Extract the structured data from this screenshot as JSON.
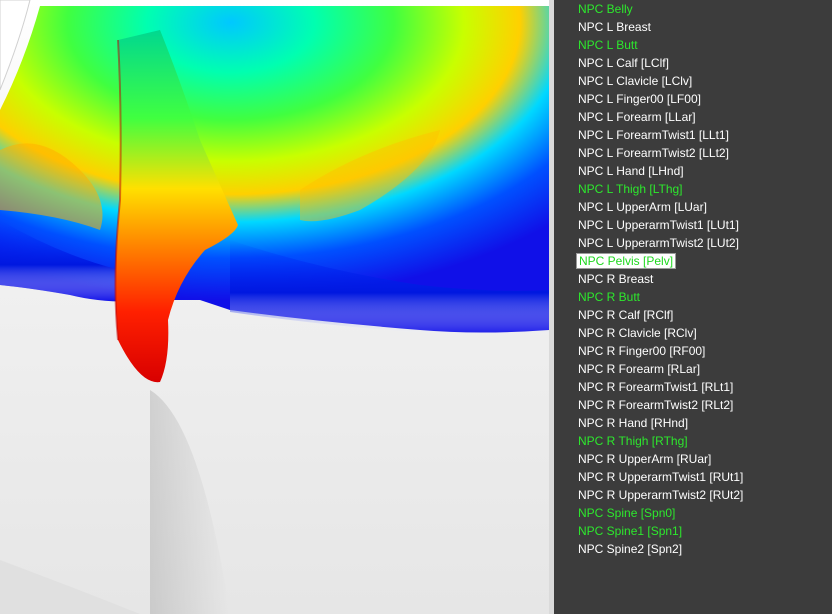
{
  "viewport": {
    "label": "3d-viewport",
    "heatmap_colors": [
      "#ff0000",
      "#ffaa00",
      "#ffff00",
      "#7fff00",
      "#00ff7f",
      "#00ffff",
      "#0080ff",
      "#0000ff",
      "#ffffff"
    ]
  },
  "bones": {
    "weighted_color": "#2de82d",
    "normal_color": "#ffffff",
    "items": [
      {
        "label": "NPC Belly",
        "weighted": true
      },
      {
        "label": "NPC L Breast",
        "weighted": false
      },
      {
        "label": "NPC L Butt",
        "weighted": true
      },
      {
        "label": "NPC L Calf [LClf]",
        "weighted": false
      },
      {
        "label": "NPC L Clavicle [LClv]",
        "weighted": false
      },
      {
        "label": "NPC L Finger00 [LF00]",
        "weighted": false
      },
      {
        "label": "NPC L Forearm [LLar]",
        "weighted": false
      },
      {
        "label": "NPC L ForearmTwist1 [LLt1]",
        "weighted": false
      },
      {
        "label": "NPC L ForearmTwist2 [LLt2]",
        "weighted": false
      },
      {
        "label": "NPC L Hand [LHnd]",
        "weighted": false
      },
      {
        "label": "NPC L Thigh [LThg]",
        "weighted": true
      },
      {
        "label": "NPC L UpperArm [LUar]",
        "weighted": false
      },
      {
        "label": "NPC L UpperarmTwist1 [LUt1]",
        "weighted": false
      },
      {
        "label": "NPC L UpperarmTwist2 [LUt2]",
        "weighted": false
      },
      {
        "label": "NPC Pelvis [Pelv]",
        "weighted": true,
        "selected": true
      },
      {
        "label": "NPC R Breast",
        "weighted": false
      },
      {
        "label": "NPC R Butt",
        "weighted": true
      },
      {
        "label": "NPC R Calf [RClf]",
        "weighted": false
      },
      {
        "label": "NPC R Clavicle [RClv]",
        "weighted": false
      },
      {
        "label": "NPC R Finger00 [RF00]",
        "weighted": false
      },
      {
        "label": "NPC R Forearm [RLar]",
        "weighted": false
      },
      {
        "label": "NPC R ForearmTwist1 [RLt1]",
        "weighted": false
      },
      {
        "label": "NPC R ForearmTwist2 [RLt2]",
        "weighted": false
      },
      {
        "label": "NPC R Hand [RHnd]",
        "weighted": false
      },
      {
        "label": "NPC R Thigh [RThg]",
        "weighted": true
      },
      {
        "label": "NPC R UpperArm [RUar]",
        "weighted": false
      },
      {
        "label": "NPC R UpperarmTwist1 [RUt1]",
        "weighted": false
      },
      {
        "label": "NPC R UpperarmTwist2 [RUt2]",
        "weighted": false
      },
      {
        "label": "NPC Spine [Spn0]",
        "weighted": true
      },
      {
        "label": "NPC Spine1 [Spn1]",
        "weighted": true
      },
      {
        "label": "NPC Spine2 [Spn2]",
        "weighted": false
      }
    ]
  }
}
